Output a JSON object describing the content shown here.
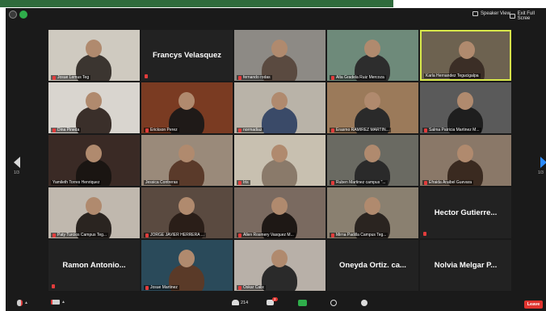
{
  "topbar": {
    "speaker_view": "Speaker View",
    "exit_full_screen": "Exit Full Scree"
  },
  "pagination": {
    "left": "1/3",
    "right": "1/3"
  },
  "participants": [
    {
      "name": "Josue Lemus Teg",
      "kind": "video",
      "bg": "#cfcac0",
      "person": "#3b3530",
      "muted": true
    },
    {
      "name": "Francys Velasquez",
      "kind": "text",
      "muted": true
    },
    {
      "name": "fernando rodas",
      "kind": "video",
      "bg": "#8d8a85",
      "person": "#5a4a40",
      "muted": true
    },
    {
      "name": "Alta Gradela Ruiz Mercoza",
      "kind": "video",
      "bg": "#6e8a7a",
      "person": "#2d2d2d",
      "muted": true
    },
    {
      "name": "Karla Hernandez Tegucigalpa",
      "kind": "video",
      "bg": "#6d6250",
      "person": "#3b2e26",
      "muted": false,
      "active": true
    },
    {
      "name": "Dina Pineda",
      "kind": "video",
      "bg": "#d9d5cf",
      "person": "#3a2f2a",
      "muted": true
    },
    {
      "name": "Erickson Perez",
      "kind": "video",
      "bg": "#7a3b22",
      "person": "#1f1a18",
      "muted": true
    },
    {
      "name": "normadiaz",
      "kind": "video",
      "bg": "#b9b3a8",
      "person": "#3a4a68",
      "muted": true
    },
    {
      "name": "Erasmo RAMIREZ MARTIN...",
      "kind": "video",
      "bg": "#9b7a5a",
      "person": "#2a2a2a",
      "muted": true
    },
    {
      "name": "Salma Patricia Martinez M...",
      "kind": "video",
      "bg": "#5a5a5a",
      "person": "#1e1e1e",
      "muted": true
    },
    {
      "name": "Yamileth Torres Henriquez",
      "kind": "video",
      "bg": "#3a2a25",
      "person": "#1a1512",
      "muted": false
    },
    {
      "name": "Jessica Contreras",
      "kind": "video",
      "bg": "#9a8a7a",
      "person": "#5a3a2a",
      "muted": false
    },
    {
      "name": "Iris",
      "kind": "video",
      "bg": "#c8c0b0",
      "person": "#8a7a6a",
      "muted": true
    },
    {
      "name": "Ruben Martinez campus \"...",
      "kind": "video",
      "bg": "#6a6a62",
      "person": "#2a2a2a",
      "muted": true
    },
    {
      "name": "Efraida Araibel Guevara",
      "kind": "video",
      "bg": "#8a7868",
      "person": "#3a2a20",
      "muted": true
    },
    {
      "name": "Paty Turcios Campus Teg...",
      "kind": "video",
      "bg": "#c0b8ae",
      "person": "#2a2420",
      "muted": true
    },
    {
      "name": "JORGE JAVIER HERRERA ...",
      "kind": "video",
      "bg": "#5a4a40",
      "person": "#2a1e18",
      "muted": true
    },
    {
      "name": "Allen Rosmery Vasquez M...",
      "kind": "video",
      "bg": "#7a6a60",
      "person": "#1e1815",
      "muted": true
    },
    {
      "name": "Mirna Padilla Campus Teg...",
      "kind": "video",
      "bg": "#8a8070",
      "person": "#2a2420",
      "muted": true
    },
    {
      "name": "Hector Gutierre...",
      "kind": "text",
      "muted": true
    },
    {
      "name": "Ramon Antonio...",
      "kind": "text",
      "muted": true
    },
    {
      "name": "Josue Martinez",
      "kind": "video",
      "bg": "#2a4a5a",
      "person": "#5a3a28",
      "muted": true
    },
    {
      "name": "Oskar Calix",
      "kind": "video",
      "bg": "#b8b0a8",
      "person": "#2a2a2a",
      "muted": true
    },
    {
      "name": "Oneyda Ortiz. ca...",
      "kind": "text",
      "muted": false
    },
    {
      "name": "Nolvia Melgar P...",
      "kind": "text",
      "muted": false
    }
  ],
  "bottombar": {
    "participants_count": "214",
    "chat_badge": "2",
    "leave_label": "Leave"
  },
  "colors": {
    "active_border": "#d8e84a",
    "leave": "#e0342f",
    "mute": "#e23c3c",
    "share": "#2fae4b",
    "top_band": "#2f6b3c"
  }
}
